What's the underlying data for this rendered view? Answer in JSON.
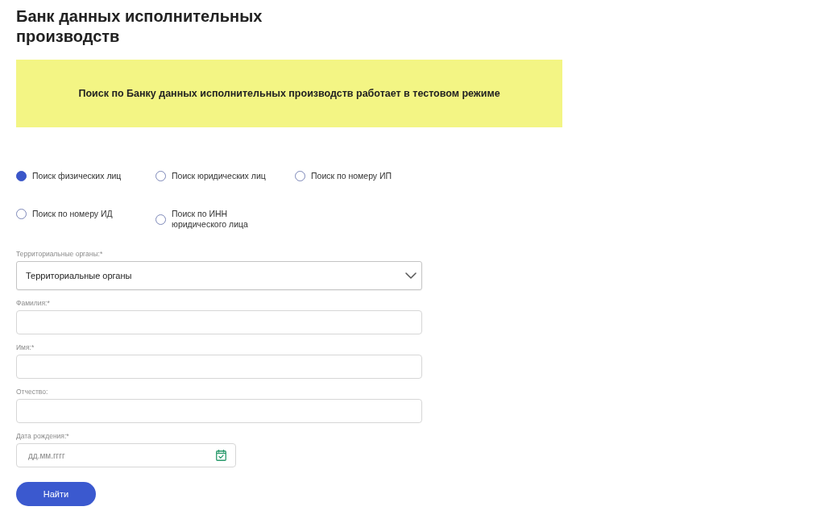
{
  "page_title": "Банк данных исполнительных производств",
  "notice": "Поиск по Банку данных исполнительных производств работает в тестовом режиме",
  "search_types": [
    {
      "label": "Поиск физических лиц",
      "selected": true
    },
    {
      "label": "Поиск юридических лиц",
      "selected": false
    },
    {
      "label": "Поиск по номеру ИП",
      "selected": false
    },
    {
      "label": "Поиск по номеру ИД",
      "selected": false
    },
    {
      "label": "Поиск по ИНН юридического лица",
      "selected": false
    }
  ],
  "form": {
    "fields": [
      {
        "kind": "select",
        "label": "Территориальные органы:*",
        "value": "Территориальные органы"
      },
      {
        "kind": "text",
        "label": "Фамилия:*"
      },
      {
        "kind": "text",
        "label": "Имя:*"
      },
      {
        "kind": "text",
        "label": "Отчество:"
      },
      {
        "kind": "date",
        "label": "Дата рождения:*",
        "placeholder": "дд.мм.гггг"
      }
    ],
    "submit_button": "Найти"
  }
}
